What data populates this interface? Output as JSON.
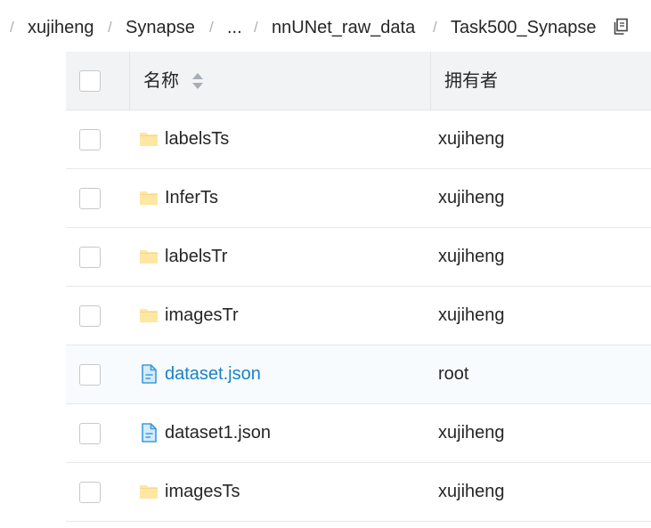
{
  "breadcrumb": {
    "items": [
      {
        "label": "xujiheng"
      },
      {
        "label": "Synapse"
      },
      {
        "label": "..."
      },
      {
        "label": "nnUNet_raw_data"
      },
      {
        "label": "Task500_Synapse"
      }
    ],
    "separator": "/",
    "copy_icon": "copy-icon"
  },
  "table": {
    "columns": {
      "name": "名称",
      "owner": "拥有者"
    },
    "rows": [
      {
        "name": "labelsTs",
        "owner": "xujiheng",
        "icon": "folder-icon",
        "highlighted": false
      },
      {
        "name": "InferTs",
        "owner": "xujiheng",
        "icon": "folder-icon",
        "highlighted": false
      },
      {
        "name": "labelsTr",
        "owner": "xujiheng",
        "icon": "folder-icon",
        "highlighted": false
      },
      {
        "name": "imagesTr",
        "owner": "xujiheng",
        "icon": "folder-icon",
        "highlighted": false
      },
      {
        "name": "dataset.json",
        "owner": "root",
        "icon": "file-icon",
        "highlighted": true
      },
      {
        "name": "dataset1.json",
        "owner": "xujiheng",
        "icon": "file-icon",
        "highlighted": false
      },
      {
        "name": "imagesTs",
        "owner": "xujiheng",
        "icon": "folder-icon",
        "highlighted": false
      }
    ]
  },
  "colors": {
    "link_active": "#1a82c6",
    "folder": "#fde7a3",
    "file": "#3d9be0",
    "header_bg": "#f2f3f5"
  }
}
